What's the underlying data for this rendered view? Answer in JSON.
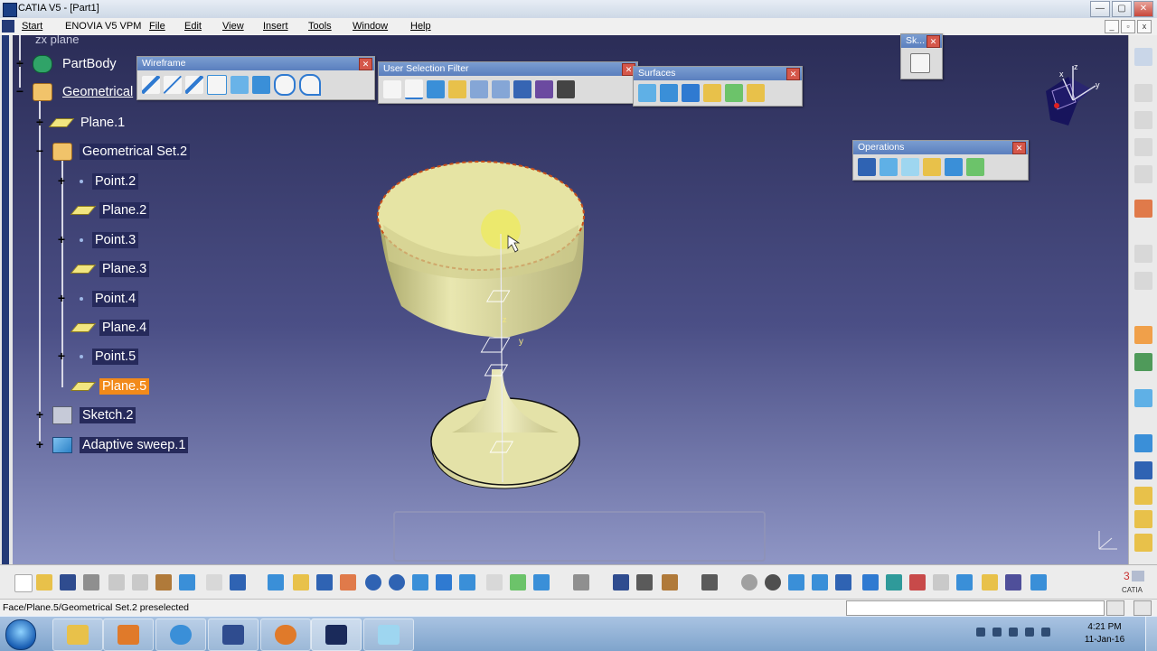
{
  "window": {
    "title": "CATIA V5 - [Part1]",
    "minimize": "—",
    "restore": "▢",
    "close": "✕"
  },
  "menu": {
    "items": [
      "Start",
      "ENOVIA V5 VPM",
      "File",
      "Edit",
      "View",
      "Insert",
      "Tools",
      "Window",
      "Help"
    ]
  },
  "tree": {
    "truncated_top": "zx plane",
    "nodes": [
      {
        "label": "PartBody"
      },
      {
        "label": "Geometrical"
      },
      {
        "label": "Plane.1"
      },
      {
        "label": "Geometrical Set.2"
      },
      {
        "label": "Point.2"
      },
      {
        "label": "Plane.2"
      },
      {
        "label": "Point.3"
      },
      {
        "label": "Plane.3"
      },
      {
        "label": "Point.4"
      },
      {
        "label": "Plane.4"
      },
      {
        "label": "Point.5"
      },
      {
        "label": "Plane.5"
      },
      {
        "label": "Sketch.2"
      },
      {
        "label": "Adaptive sweep.1"
      }
    ]
  },
  "toolbars": {
    "wireframe": {
      "title": "Wireframe"
    },
    "user_selection_filter": {
      "title": "User Selection Filter"
    },
    "surfaces": {
      "title": "Surfaces"
    },
    "sketch": {
      "title": "Sk..."
    },
    "operations": {
      "title": "Operations"
    },
    "close_glyph": "✕"
  },
  "axis": {
    "x": "x",
    "y": "y",
    "z": "z"
  },
  "status": {
    "message": "Face/Plane.5/Geometrical Set.2 preselected"
  },
  "taskbar": {
    "time": "4:21 PM",
    "date": "11-Jan-16"
  },
  "colors": {
    "viewport_bg": "#2c2e5c",
    "selection": "#f28a1a",
    "part_surface": "#e6e4a4"
  }
}
